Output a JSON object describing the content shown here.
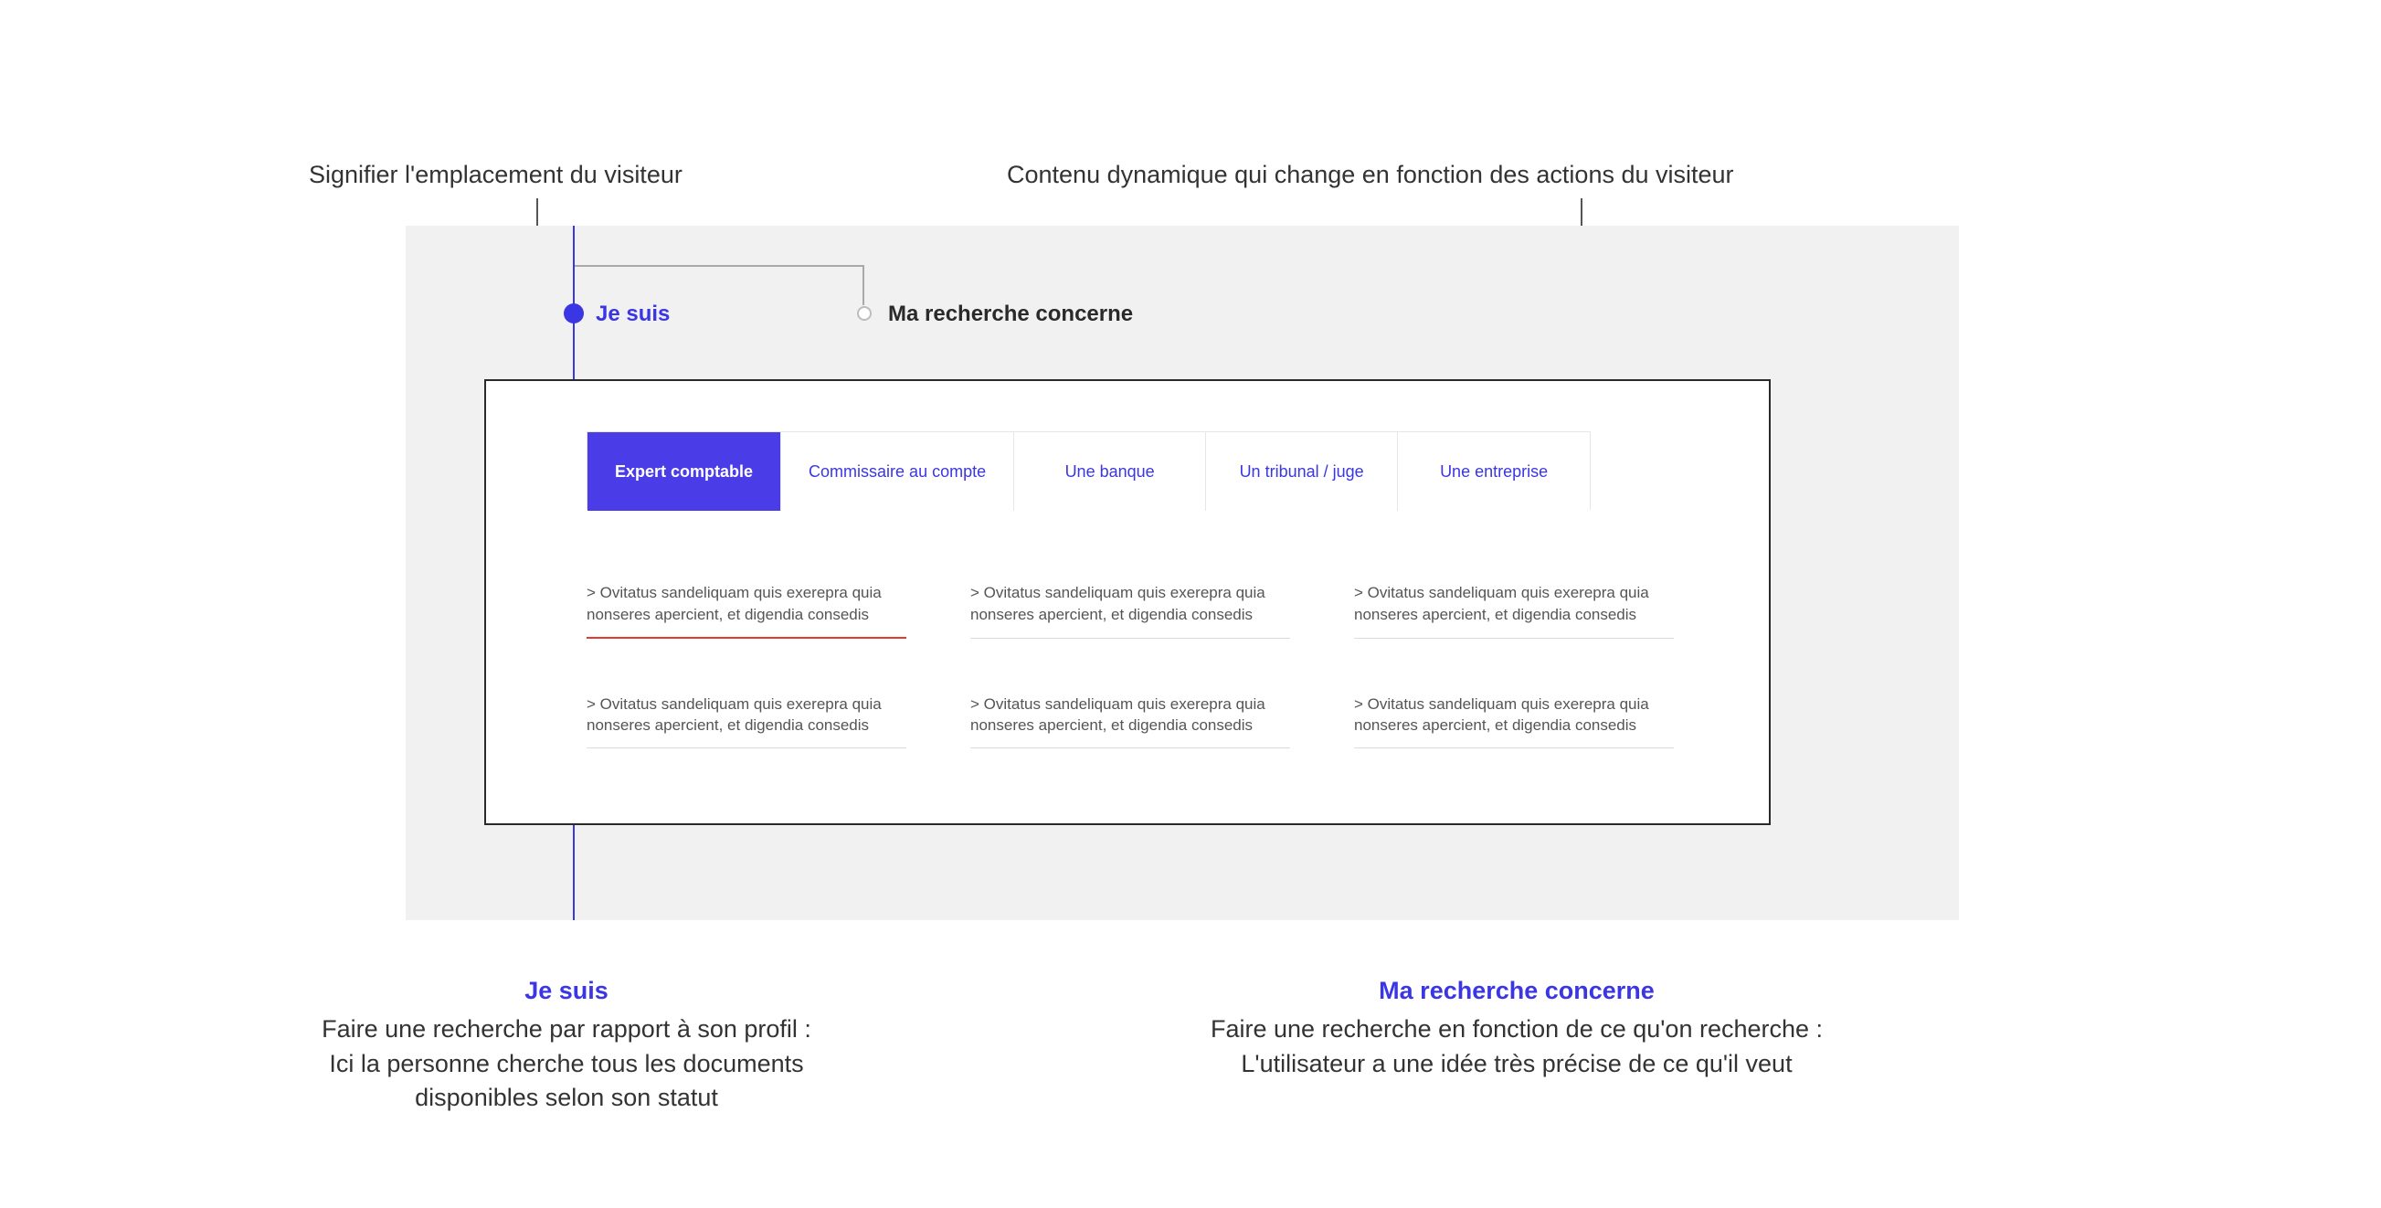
{
  "annotations": {
    "left": "Signifier l'emplacement du visiteur",
    "right": "Contenu dynamique qui change en fonction des actions du visiteur"
  },
  "steps": {
    "active_label": "Je suis",
    "inactive_label": "Ma recherche concerne"
  },
  "tabs": [
    "Expert comptable",
    "Commissaire au compte",
    "Une banque",
    "Un tribunal / juge",
    "Une entreprise"
  ],
  "result_text": "> Ovitatus sandeliquam quis exerepra quia nonseres apercient, et digendia consedis",
  "columns": {
    "left": {
      "title": "Je suis",
      "line1": "Faire une recherche par rapport à son profil :",
      "line2": "Ici la personne cherche tous les documents",
      "line3": "disponibles selon son statut"
    },
    "right": {
      "title": "Ma recherche concerne",
      "line1": "Faire une recherche en fonction de ce qu'on recherche :",
      "line2": "L'utilisateur a une idée très précise de ce qu'il veut"
    }
  }
}
